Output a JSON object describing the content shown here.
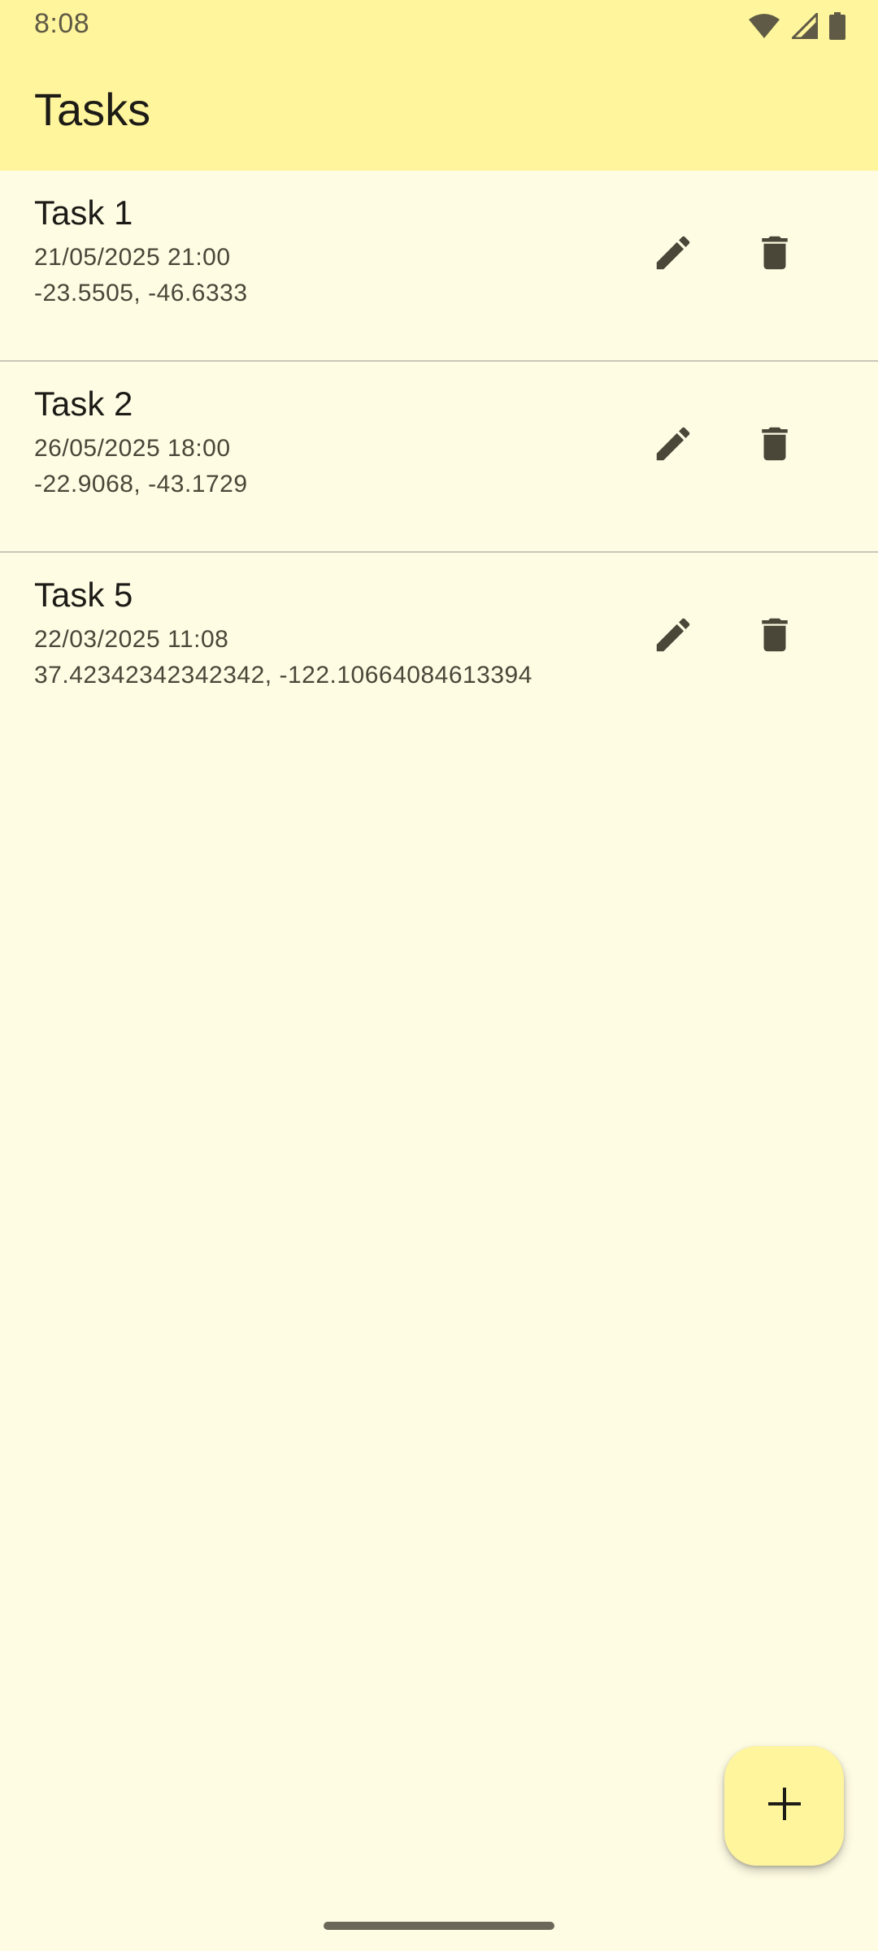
{
  "status_bar": {
    "time": "8:08",
    "icons": [
      "wifi-icon",
      "cell-signal-icon",
      "battery-icon"
    ]
  },
  "app_bar": {
    "title": "Tasks"
  },
  "tasks": [
    {
      "title": "Task 1",
      "date": "21/05/2025 21:00",
      "location": "-23.5505, -46.6333",
      "actions": [
        "edit-icon",
        "delete-icon"
      ]
    },
    {
      "title": "Task 2",
      "date": "26/05/2025 18:00",
      "location": "-22.9068, -43.1729",
      "actions": [
        "edit-icon",
        "delete-icon"
      ]
    },
    {
      "title": "Task 5",
      "date": "22/03/2025 11:08",
      "location": "37.42342342342342, -122.10664084613394",
      "actions": [
        "edit-icon",
        "delete-icon"
      ]
    }
  ],
  "fab": {
    "icon": "add-icon"
  },
  "colors": {
    "app_bar_background": "#FFF59D",
    "page_background": "#FFFCE4",
    "icon_color": "#4A4739",
    "divider": "#C9C7BC"
  }
}
